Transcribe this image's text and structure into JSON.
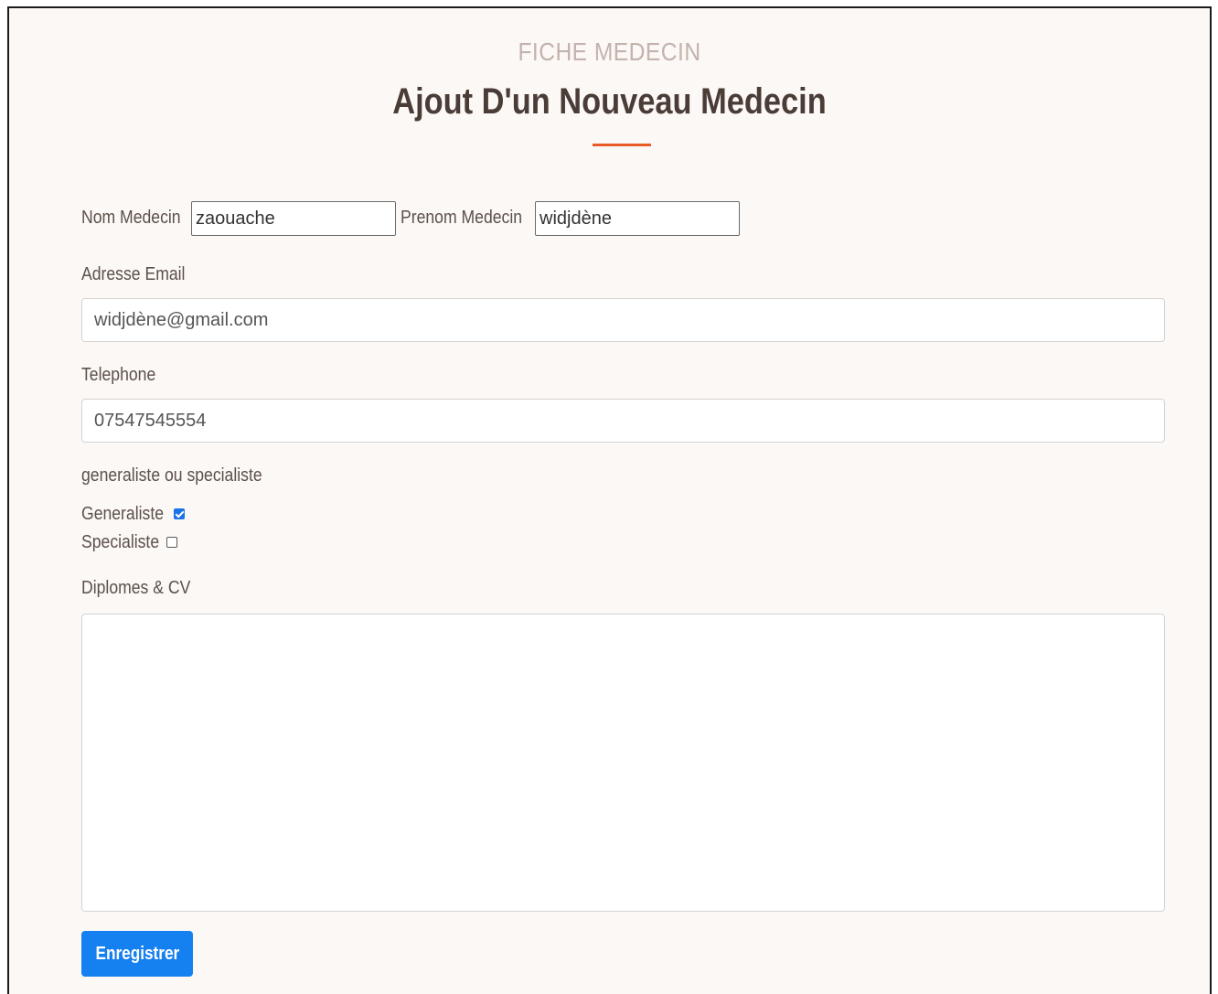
{
  "header": {
    "eyebrow": "FICHE MEDECIN",
    "title": "Ajout D'un Nouveau Medecin",
    "accent_color": "#e85a26"
  },
  "form": {
    "nom_label": "Nom Medecin",
    "nom_value": "zaouache",
    "prenom_label": "Prenom Medecin",
    "prenom_value": "widjdène",
    "email_label": "Adresse Email",
    "email_value": "widjdène@gmail.com",
    "telephone_label": "Telephone",
    "telephone_value": "07547545554",
    "type_label": "generaliste ou specialiste",
    "options": [
      {
        "label": "Generaliste",
        "checked": true
      },
      {
        "label": "Specialiste",
        "checked": false
      }
    ],
    "cv_label": "Diplomes & CV",
    "cv_value": "",
    "submit_label": "Enregistrer",
    "button_color": "#1580f0"
  }
}
